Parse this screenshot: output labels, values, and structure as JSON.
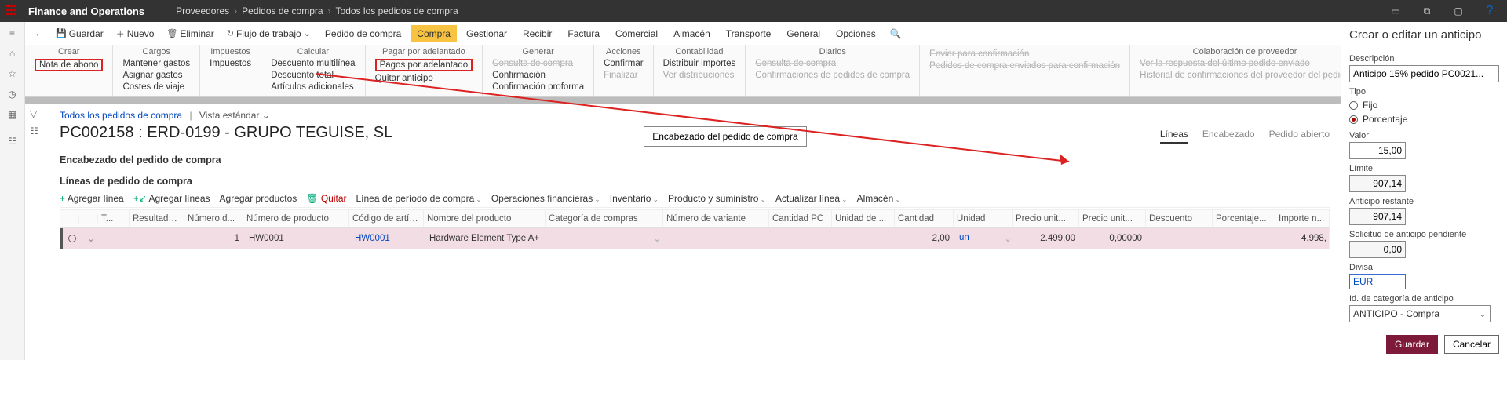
{
  "brand": "Finance and Operations",
  "breadcrumb": [
    "Proveedores",
    "Pedidos de compra",
    "Todos los pedidos de compra"
  ],
  "actions": {
    "save": "Guardar",
    "new": "Nuevo",
    "delete": "Eliminar",
    "workflow": "Flujo de trabajo",
    "tabs": [
      "Pedido de compra",
      "Compra",
      "Gestionar",
      "Recibir",
      "Factura",
      "Comercial",
      "Almacén",
      "Transporte",
      "General",
      "Opciones"
    ]
  },
  "ribbon": {
    "groups": [
      {
        "title": "Crear",
        "items": [
          {
            "t": "Nota de abono",
            "box": true
          }
        ]
      },
      {
        "title": "Cargos",
        "items": [
          {
            "t": "Mantener gastos"
          },
          {
            "t": "Asignar gastos"
          },
          {
            "t": "Costes de viaje"
          }
        ]
      },
      {
        "title": "Impuestos",
        "items": [
          {
            "t": "Impuestos"
          }
        ]
      },
      {
        "title": "Calcular",
        "items": [
          {
            "t": "Descuento multilínea"
          },
          {
            "t": "Descuento total"
          },
          {
            "t": "Artículos adicionales"
          }
        ]
      },
      {
        "title": "Pagar por adelantado",
        "items": [
          {
            "t": "Pagos por adelantado",
            "box": true
          },
          {
            "t": "Quitar anticipo"
          }
        ]
      },
      {
        "title": "Generar",
        "items": [
          {
            "t": "Consulta de compra",
            "d": true
          },
          {
            "t": "Confirmación"
          },
          {
            "t": "Confirmación proforma"
          }
        ]
      },
      {
        "title": "Acciones",
        "items": [
          {
            "t": "Confirmar"
          },
          {
            "t": "Finalizar",
            "d": true
          }
        ]
      },
      {
        "title": "Contabilidad",
        "items": [
          {
            "t": "Distribuir importes"
          },
          {
            "t": "Ver distribuciones",
            "d": true
          }
        ]
      },
      {
        "title": "Diarios",
        "items": [
          {
            "t": "Consulta de compra",
            "d": true
          },
          {
            "t": "Confirmaciones de pedidos de compra",
            "d": true
          }
        ]
      },
      {
        "title": "",
        "items": [
          {
            "t": "Enviar para confirmación",
            "d": true
          },
          {
            "t": "Pedidos de compra enviados para confirmación",
            "d": true
          }
        ]
      },
      {
        "title": "Colaboración de proveedor",
        "items": [
          {
            "t": "Ver la respuesta del último pedido enviado",
            "d": true
          },
          {
            "t": "Historial de confirmaciones del proveedor del pedido",
            "d": true
          }
        ]
      }
    ]
  },
  "page": {
    "list_link": "Todos los pedidos de compra",
    "view": "Vista estándar",
    "title": "PC002158 : ERD-0199 - GRUPO TEGUISE, SL",
    "po_header_btn": "Encabezado del pedido de compra",
    "view_tabs": {
      "lines": "Líneas",
      "header": "Encabezado",
      "open": "Pedido abierto"
    },
    "section_header": "Encabezado del pedido de compra",
    "section_lines": "Líneas de pedido de compra"
  },
  "line_toolbar": [
    {
      "t": "Agregar línea",
      "i": "+"
    },
    {
      "t": "Agregar líneas",
      "i": "+↙"
    },
    {
      "t": "Agregar productos"
    },
    {
      "t": "Quitar",
      "i": "🗑",
      "class": "red"
    },
    {
      "t": "Línea de período de compra",
      "dd": true
    },
    {
      "t": "Operaciones financieras",
      "dd": true
    },
    {
      "t": "Inventario",
      "dd": true
    },
    {
      "t": "Producto y suministro",
      "dd": true
    },
    {
      "t": "Actualizar línea",
      "dd": true
    },
    {
      "t": "Almacén",
      "dd": true
    }
  ],
  "grid": {
    "cols": [
      "",
      "",
      "T...",
      "Resultados...",
      "Número d...",
      "Número de producto",
      "Código de artículo",
      "Nombre del producto",
      "Categoría de compras",
      "Número de variante",
      "Cantidad PC",
      "Unidad de ...",
      "Cantidad",
      "Unidad",
      "Precio unit...",
      "Precio unit...",
      "Descuento",
      "Porcentaje...",
      "Importe n..."
    ],
    "row": {
      "line_no": "1",
      "product_no": "HW0001",
      "item_code": "HW0001",
      "product_name": "Hardware Element Type A+",
      "qty": "2,00",
      "unit": "un",
      "unit_price": "2.499,00",
      "unit_price2": "0,00000",
      "net": "4.998,"
    }
  },
  "panel": {
    "title": "Crear o editar un anticipo",
    "desc_label": "Descripción",
    "desc_value": "Anticipo 15% pedido PC0021...",
    "type_label": "Tipo",
    "type_fixed": "Fijo",
    "type_pct": "Porcentaje",
    "value_label": "Valor",
    "value": "15,00",
    "limit_label": "Límite",
    "limit": "907,14",
    "remaining_label": "Anticipo restante",
    "remaining": "907,14",
    "pending_label": "Solicitud de anticipo pendiente",
    "pending": "0,00",
    "currency_label": "Divisa",
    "currency": "EUR",
    "cat_label": "Id. de categoría de anticipo",
    "cat_value": "ANTICIPO - Compra",
    "save": "Guardar",
    "cancel": "Cancelar"
  }
}
